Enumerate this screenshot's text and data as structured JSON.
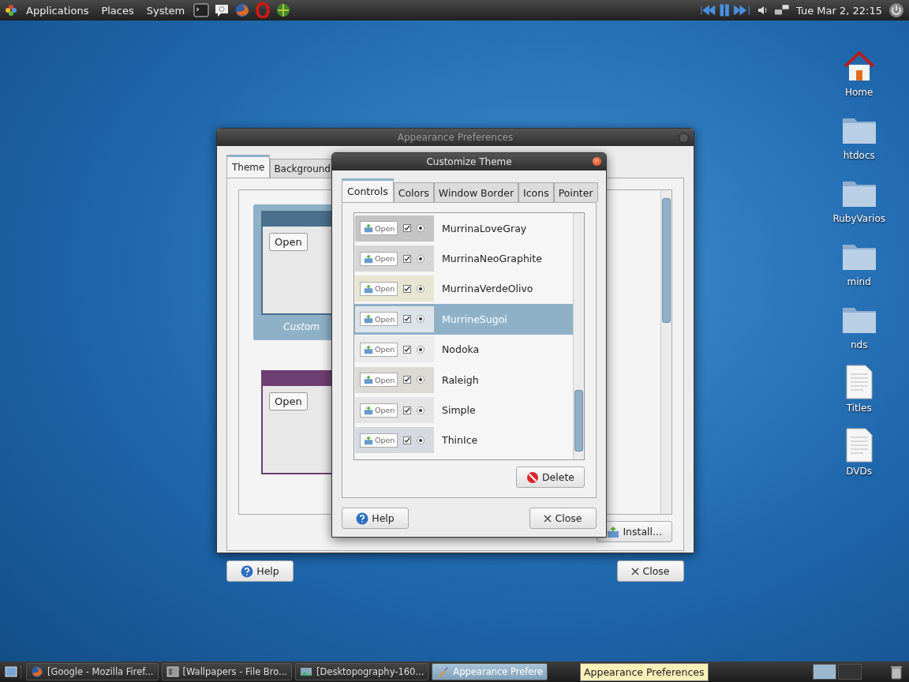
{
  "top_panel": {
    "menus": [
      "Applications",
      "Places",
      "System"
    ],
    "launchers": [
      {
        "kind": "terminal"
      },
      {
        "kind": "mail"
      },
      {
        "kind": "browser"
      },
      {
        "kind": "ring"
      },
      {
        "kind": "globe"
      }
    ],
    "clock": "Tue Mar 2, 22:15"
  },
  "desktop_icons": [
    {
      "label": "Home",
      "kind": "home"
    },
    {
      "label": "htdocs",
      "kind": "folder"
    },
    {
      "label": "RubyVarios",
      "kind": "folder"
    },
    {
      "label": "mind",
      "kind": "folder"
    },
    {
      "label": "nds",
      "kind": "folder"
    },
    {
      "label": "Titles",
      "kind": "document"
    },
    {
      "label": "DVDs",
      "kind": "document"
    }
  ],
  "appearance_window": {
    "title": "Appearance Preferences",
    "tabs": [
      {
        "label": "Theme",
        "selected": true
      },
      {
        "label": "Background",
        "selected": false
      }
    ],
    "themes": [
      {
        "preview_button": "Open",
        "caption": "Custom",
        "selected": true,
        "color": "#4a6f8c"
      },
      {
        "preview_button": "Open",
        "selected": false,
        "color": "#6e3f72"
      }
    ],
    "install_button": "Install...",
    "help_button": "Help",
    "close_button": "Close"
  },
  "customize_dialog": {
    "title": "Customize Theme",
    "tabs": [
      {
        "label": "Controls",
        "selected": true
      },
      {
        "label": "Colors",
        "selected": false
      },
      {
        "label": "Window Border",
        "selected": false
      },
      {
        "label": "Icons",
        "selected": false
      },
      {
        "label": "Pointer",
        "selected": false
      }
    ],
    "themes": [
      {
        "name": "MurrinaLoveGray",
        "preview_button": "Open",
        "color": "#c4c4c4",
        "selected": false
      },
      {
        "name": "MurrinaNeoGraphite",
        "preview_button": "Open",
        "color": "#d6d6d6",
        "selected": false
      },
      {
        "name": "MurrinaVerdeOlivo",
        "preview_button": "Open",
        "color": "#e8e6d2",
        "selected": false
      },
      {
        "name": "MurrineSugoi",
        "preview_button": "Open",
        "color": "#dde4e9",
        "selected": true
      },
      {
        "name": "Nodoka",
        "preview_button": "Open",
        "color": "#ebebeb",
        "selected": false
      },
      {
        "name": "Raleigh",
        "preview_button": "Open",
        "color": "#dcdad5",
        "selected": false
      },
      {
        "name": "Simple",
        "preview_button": "Open",
        "color": "#e4e4e4",
        "selected": false
      },
      {
        "name": "ThinIce",
        "preview_button": "Open",
        "color": "#d6d8e2",
        "selected": false
      }
    ],
    "delete_button": "Delete",
    "help_button": "Help",
    "close_button": "Close"
  },
  "taskbar": {
    "tasks": [
      {
        "label": "[Google - Mozilla Firef...",
        "kind": "browser",
        "selected": false
      },
      {
        "label": "[Wallpapers - File Bro...",
        "kind": "files",
        "selected": false
      },
      {
        "label": "[Desktopography-160...",
        "kind": "image",
        "selected": false
      },
      {
        "label": "Appearance Prefere",
        "kind": "appearance",
        "selected": true
      }
    ],
    "tooltip": "Appearance Preferences"
  }
}
